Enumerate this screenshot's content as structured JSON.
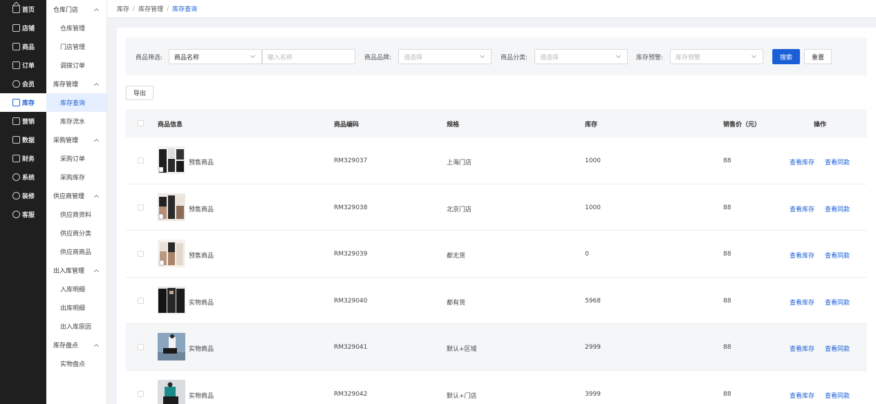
{
  "nav_primary": [
    {
      "label": "首页",
      "icon": "home-icon"
    },
    {
      "label": "店铺",
      "icon": "shop-icon"
    },
    {
      "label": "商品",
      "icon": "goods-icon"
    },
    {
      "label": "订单",
      "icon": "order-icon"
    },
    {
      "label": "会员",
      "icon": "member-icon"
    },
    {
      "label": "库存",
      "icon": "inventory-icon",
      "active": true
    },
    {
      "label": "营销",
      "icon": "marketing-icon"
    },
    {
      "label": "数据",
      "icon": "data-icon"
    },
    {
      "label": "财务",
      "icon": "finance-icon"
    },
    {
      "label": "系统",
      "icon": "system-icon"
    },
    {
      "label": "装修",
      "icon": "decoration-icon"
    },
    {
      "label": "客服",
      "icon": "service-icon"
    }
  ],
  "nav_secondary": [
    {
      "group": "仓库门店",
      "items": [
        "仓库管理",
        "门店管理",
        "调拨订单"
      ]
    },
    {
      "group": "库存管理",
      "items": [
        "库存查询",
        "库存流水"
      ]
    },
    {
      "group": "采购管理",
      "items": [
        "采购订单",
        "采购库存"
      ]
    },
    {
      "group": "供应商管理",
      "items": [
        "供应商资料",
        "供应商分类",
        "供应商商品"
      ]
    },
    {
      "group": "出入库管理",
      "items": [
        "入库明细",
        "出库明细",
        "出入库原因"
      ]
    },
    {
      "group": "库存盘点",
      "items": [
        "实物盘点"
      ]
    }
  ],
  "breadcrumb": [
    "库存",
    "库存管理",
    "库存查询"
  ],
  "filters": {
    "goods_filter_label": "商品筛选:",
    "goods_filter_select": "商品名称",
    "goods_filter_input_placeholder": "输入名称",
    "brand_label": "商品品牌:",
    "brand_placeholder": "请选择",
    "category_label": "商品分类:",
    "category_placeholder": "请选择",
    "warning_label": "库存预警:",
    "warning_placeholder": "库存预警",
    "search_label": "搜索",
    "reset_label": "重置"
  },
  "export_label": "导出",
  "table": {
    "headers": {
      "info": "商品信息",
      "code": "商品编码",
      "spec": "规格",
      "stock": "库存",
      "price": "销售价（元）",
      "ops": "操作"
    },
    "rows": [
      {
        "name": "预售商品",
        "code": "RM329037",
        "spec": "上海门店",
        "stock": "1000",
        "price": "88",
        "op1": "查看库存",
        "op2": "查看同款"
      },
      {
        "name": "预售商品",
        "code": "RM329038",
        "spec": "北京门店",
        "stock": "1000",
        "price": "88",
        "op1": "查看库存",
        "op2": "查看同款"
      },
      {
        "name": "预售商品",
        "code": "RM329039",
        "spec": "都无货",
        "stock": "0",
        "price": "88",
        "op1": "查看库存",
        "op2": "查看同款"
      },
      {
        "name": "实物商品",
        "code": "RM329040",
        "spec": "都有货",
        "stock": "5968",
        "price": "88",
        "op1": "查看库存",
        "op2": "查看同款"
      },
      {
        "name": "实物商品",
        "code": "RM329041",
        "spec": "默认+区域",
        "stock": "2999",
        "price": "88",
        "op1": "查看库存",
        "op2": "查看同款"
      },
      {
        "name": "实物商品",
        "code": "RM329042",
        "spec": "默认+门店",
        "stock": "3999",
        "price": "88",
        "op1": "查看库存",
        "op2": "查看同款"
      }
    ]
  },
  "colors": {
    "accent": "#1a5fd8",
    "sidebar_bg": "#1f1f1f"
  }
}
